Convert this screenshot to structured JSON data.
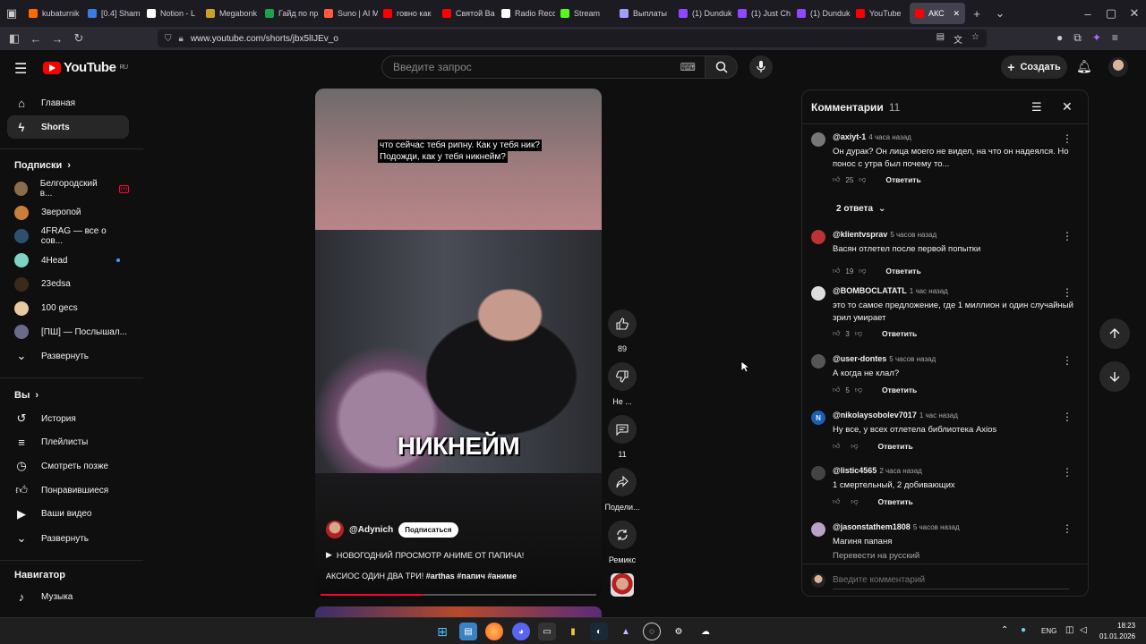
{
  "browser": {
    "tabs": [
      {
        "label": "kubaturnik",
        "color": "#ff6a00"
      },
      {
        "label": "[0.4] Sham",
        "color": "#3b7ddd"
      },
      {
        "label": "Notion - L",
        "color": "#ffffff"
      },
      {
        "label": "Megabonk",
        "color": "#c9a227"
      },
      {
        "label": "Гайд по пр",
        "color": "#1aa34a"
      },
      {
        "label": "Suno | AI M",
        "color": "#ff5a3c"
      },
      {
        "label": "говно как",
        "color": "#ff0000"
      },
      {
        "label": "Святой Ва",
        "color": "#ff0000"
      },
      {
        "label": "Radio Reco",
        "color": "#ffffff"
      },
      {
        "label": "Stream",
        "color": "#53fc18"
      },
      {
        "label": "Выплаты",
        "color": "#9f9fff"
      },
      {
        "label": "(1) Dunduk",
        "color": "#9146ff"
      },
      {
        "label": "(1) Just Ch",
        "color": "#9146ff"
      },
      {
        "label": "(1) Dunduk",
        "color": "#9146ff"
      },
      {
        "label": "YouTube",
        "color": "#ff0000"
      },
      {
        "label": "АКС",
        "color": "#ff0000"
      }
    ],
    "url": "www.youtube.com/shorts/jbx5lIJEv_o"
  },
  "header": {
    "logo": "YouTube",
    "logo_region": "RU",
    "search_placeholder": "Введите запрос",
    "create_label": "Создать"
  },
  "sidebar": {
    "main": [
      {
        "label": "Главная",
        "icon": "home-icon"
      },
      {
        "label": "Shorts",
        "icon": "shorts-icon"
      }
    ],
    "subs_title": "Подписки",
    "subs": [
      {
        "label": "Белгородский в...",
        "color": "#8a6d4a",
        "badge": "(•)"
      },
      {
        "label": "Зверопой",
        "color": "#c87f3a"
      },
      {
        "label": "4FRAG — все о сов...",
        "color": "#2f4f6f"
      },
      {
        "label": "4Head",
        "color": "#7fd3c4"
      },
      {
        "label": "23edsa",
        "color": "#3a2a1a"
      },
      {
        "label": "100 gecs",
        "color": "#e8c9a0"
      },
      {
        "label": "[ПШ] — Послышал...",
        "color": "#6a6a8a"
      }
    ],
    "expand1": "Развернуть",
    "you_title": "Вы",
    "you": [
      {
        "label": "История",
        "icon": "history-icon"
      },
      {
        "label": "Плейлисты",
        "icon": "playlists-icon"
      },
      {
        "label": "Смотреть позже",
        "icon": "watch-later-icon"
      },
      {
        "label": "Понравившиеся",
        "icon": "liked-icon"
      },
      {
        "label": "Ваши видео",
        "icon": "your-videos-icon"
      }
    ],
    "expand2": "Развернуть",
    "nav_title": "Навигатор",
    "nav": [
      {
        "label": "Музыка",
        "icon": "music-icon"
      }
    ]
  },
  "video": {
    "subtitle_1": "что сейчас тебя рипну. Как у тебя ник?",
    "subtitle_2": "Подожди, как у тебя никнейм?",
    "overlay": "НИКНЕЙМ",
    "channel": "@Adynich",
    "subscribe": "Подписаться",
    "title": "НОВОГОДНИЙ ПРОСМОТР АНИМЕ ОТ ПАПИЧА!",
    "desc_plain": "АКСИОС ОДИН ДВА ТРИ! ",
    "hashtags": "#arthas #папич #аниме",
    "progress": 0.37
  },
  "actions": {
    "likes": "89",
    "dislike": "Не ...",
    "comments": "11",
    "share": "Подели...",
    "remix": "Ремикс"
  },
  "comments": {
    "title": "Комментарии",
    "count": "11",
    "replies_label": "2 ответа",
    "reply_label": "Ответить",
    "translate": "Перевести на русский",
    "input_placeholder": "Введите комментарий",
    "items": [
      {
        "author": "@axiyt-1",
        "time": "4 часа назад",
        "text": "Он дурак? Он лица моего не видел, на что он надеялся. Но понос с утра был почему то...",
        "likes": "25",
        "color": "#777"
      },
      {
        "author": "@klientvsprav",
        "time": "5 часов назад",
        "text": "Васян отлетел после первой попытки",
        "likes": "19",
        "color": "#b33"
      },
      {
        "author": "@BOMBOCLATATL",
        "time": "1 час назад",
        "text": "это то самое предложение, где 1 миллион и один случайный зрил умирает",
        "likes": "3",
        "color": "#ddd"
      },
      {
        "author": "@user-dontes",
        "time": "5 часов назад",
        "text": "А когда не клал?",
        "likes": "5",
        "color": "#555"
      },
      {
        "author": "@nikolaysobolev7017",
        "time": "1 час назад",
        "text": "Ну все, у всех отлетела библиотека Axios",
        "likes": "",
        "color": "#1a5fb4",
        "initial": "N"
      },
      {
        "author": "@listic4565",
        "time": "2 часа назад",
        "text": "1 смертельный, 2 добивающих",
        "likes": "",
        "color": "#444"
      },
      {
        "author": "@jasonstathem1808",
        "time": "5 часов назад",
        "text": "Магиня папаня",
        "likes": "",
        "color": "#b9a0c8"
      }
    ]
  },
  "taskbar": {
    "lang": "ENG",
    "time": "18:23",
    "date": "01.01.2026"
  }
}
